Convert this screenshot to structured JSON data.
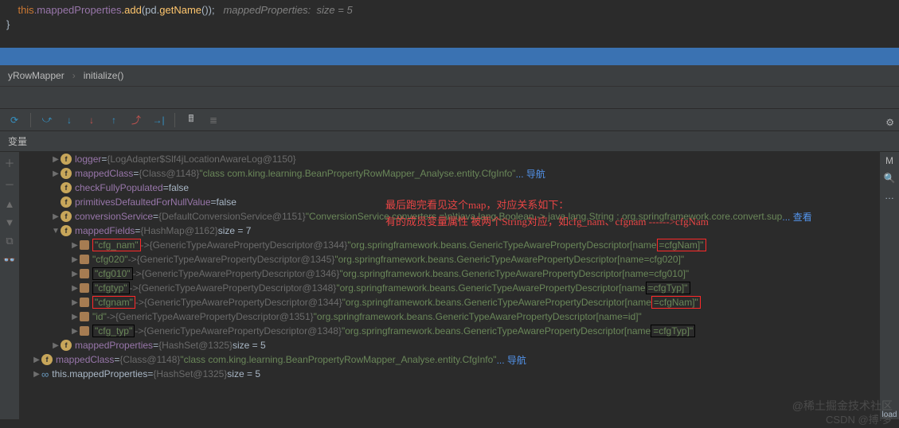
{
  "code": {
    "line1_this": "this",
    "line1_field": ".mappedProperties",
    "line1_method": ".add",
    "line1_args": "(pd.",
    "line1_getname": "getName",
    "line1_close": "());",
    "line1_comment": "   mappedProperties:  size = 5",
    "line2": "}"
  },
  "breadcrumb": {
    "class": "yRowMapper",
    "method": "initialize()"
  },
  "panel": {
    "vars_label": "变量",
    "m_label": "M"
  },
  "annotations": {
    "line1": "最后跑完看见这个map，对应关系如下：",
    "line2": "有的成员变量属性 被两个String对应，如cfg_nam、cfgnam ------>cfgNam"
  },
  "vars": {
    "logger": {
      "name": "logger",
      "val": "{LogAdapter$Slf4jLocationAwareLog@1150}"
    },
    "mappedClass": {
      "name": "mappedClass",
      "cls": "{Class@1148}",
      "str": "\"class com.king.learning.BeanPropertyRowMapper_Analyse.entity.CfgInfo\"",
      "nav": "... 导航"
    },
    "checkFullyPopulated": {
      "name": "checkFullyPopulated",
      "val": "false"
    },
    "primitivesDefaultedForNullValue": {
      "name": "primitivesDefaultedForNullValue",
      "val": "false"
    },
    "conversionService": {
      "name": "conversionService",
      "cls": "{DefaultConversionService@1151}",
      "str": "\"ConversionService converters =\\n\\tjava.lang.Boolean -> java.lang.String : org.springframework.core.convert.sup",
      "view": "... 查看"
    },
    "mappedFields": {
      "name": "mappedFields",
      "cls": "{HashMap@1162}",
      "size": "size = 7"
    },
    "entries": [
      {
        "key": "\"cfg_nam\"",
        "ref": "{GenericTypeAwarePropertyDescriptor@1344}",
        "str_prefix": "\"org.springframework.beans.GenericTypeAwarePropertyDescriptor[name",
        "str_suffix": "=cfgNam]\"",
        "key_box": "red",
        "suffix_box": "red"
      },
      {
        "key": "\"cfg020\"",
        "ref": "{GenericTypeAwarePropertyDescriptor@1345}",
        "str_prefix": "\"org.springframework.beans.GenericTypeAwarePropertyDescriptor[name=cfg020]\"",
        "str_suffix": "",
        "key_box": "none",
        "suffix_box": "none"
      },
      {
        "key": "\"cfg010\"",
        "ref": "{GenericTypeAwarePropertyDescriptor@1346}",
        "str_prefix": "\"org.springframework.beans.GenericTypeAwarePropertyDescriptor[name=cfg010]\"",
        "str_suffix": "",
        "key_box": "black",
        "suffix_box": "none"
      },
      {
        "key": "\"cfgtyp\"",
        "ref": "{GenericTypeAwarePropertyDescriptor@1348}",
        "str_prefix": "\"org.springframework.beans.GenericTypeAwarePropertyDescriptor[name",
        "str_suffix": "=cfgTyp]\"",
        "key_box": "black",
        "suffix_box": "black"
      },
      {
        "key": "\"cfgnam\"",
        "ref": "{GenericTypeAwarePropertyDescriptor@1344}",
        "str_prefix": "\"org.springframework.beans.GenericTypeAwarePropertyDescriptor[name",
        "str_suffix": "=cfgNam]\"",
        "key_box": "red",
        "suffix_box": "red"
      },
      {
        "key": "\"id\"",
        "ref": "{GenericTypeAwarePropertyDescriptor@1351}",
        "str_prefix": "\"org.springframework.beans.GenericTypeAwarePropertyDescriptor[name=id]\"",
        "str_suffix": "",
        "key_box": "none",
        "suffix_box": "none"
      },
      {
        "key": "\"cfg_typ\"",
        "ref": "{GenericTypeAwarePropertyDescriptor@1348}",
        "str_prefix": "\"org.springframework.beans.GenericTypeAwarePropertyDescriptor[name",
        "str_suffix": "=cfgTyp]\"",
        "key_box": "black",
        "suffix_box": "black"
      }
    ],
    "mappedPropertiesInner": {
      "name": "mappedProperties",
      "cls": "{HashSet@1325}",
      "size": "size = 5"
    },
    "mappedClass2": {
      "name": "mappedClass",
      "cls": "{Class@1148}",
      "str": "\"class com.king.learning.BeanPropertyRowMapper_Analyse.entity.CfgInfo\"",
      "nav": "... 导航"
    },
    "thisMappedProperties": {
      "name": "this.mappedProperties",
      "cls": "{HashSet@1325}",
      "size": "size = 5"
    }
  },
  "sidebar": {
    "load": "load"
  },
  "watermark": {
    "line1": "@稀土掘金技术社区",
    "line2": "CSDN @搏·梦"
  }
}
